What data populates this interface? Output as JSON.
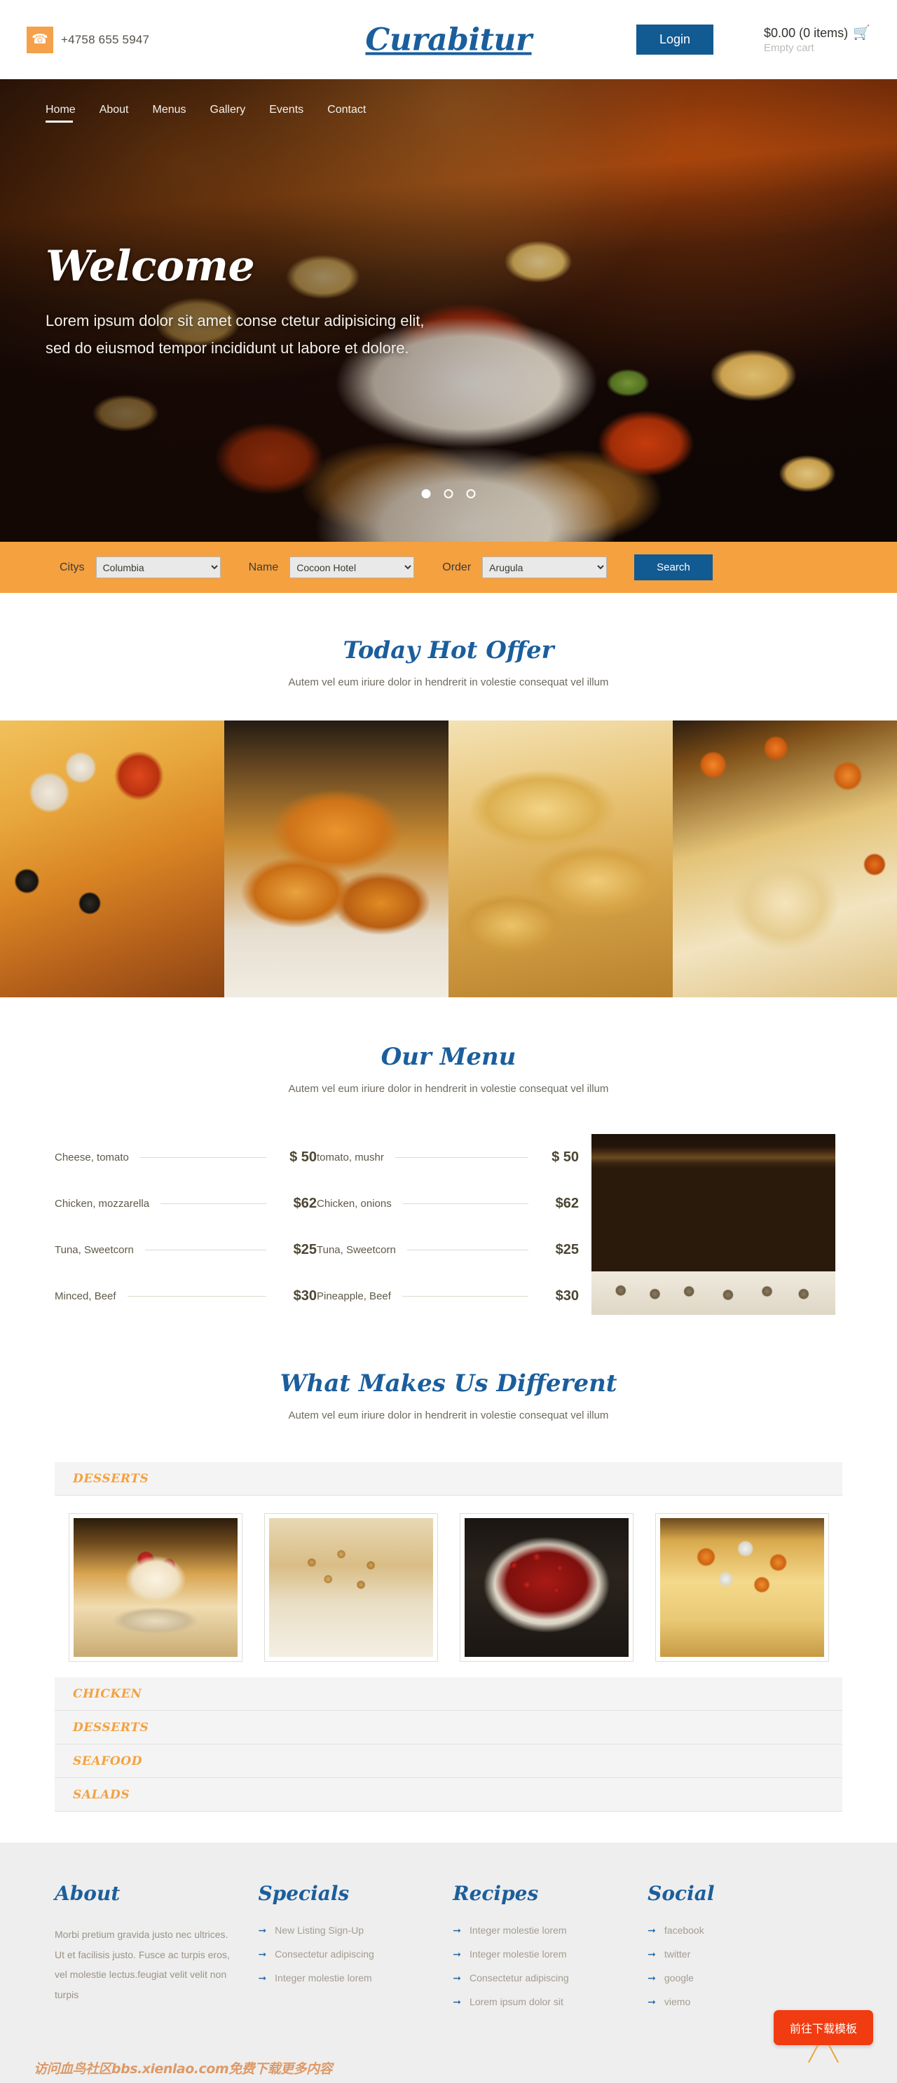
{
  "header": {
    "phone_icon": "phone-icon",
    "phone": "+4758 655 5947",
    "brand": "Curabitur",
    "login_label": "Login",
    "cart_total": "$0.00 (0 items)",
    "cart_icon": "shopping-cart-icon",
    "cart_status": "Empty cart"
  },
  "nav": {
    "items": [
      {
        "label": "Home",
        "active": true
      },
      {
        "label": "About",
        "active": false
      },
      {
        "label": "Menus",
        "active": false
      },
      {
        "label": "Gallery",
        "active": false
      },
      {
        "label": "Events",
        "active": false
      },
      {
        "label": "Contact",
        "active": false
      }
    ]
  },
  "hero": {
    "title": "Welcome",
    "line1": "Lorem ipsum dolor sit amet conse ctetur adipisicing elit,",
    "line2": "sed do eiusmod tempor incididunt ut labore et dolore.",
    "dots": [
      true,
      false,
      false
    ]
  },
  "searchbar": {
    "city_label": "Citys",
    "city_value": "Columbia",
    "city_options": [
      "Columbia"
    ],
    "name_label": "Name",
    "name_value": "Cocoon Hotel",
    "name_options": [
      "Cocoon Hotel"
    ],
    "order_label": "Order",
    "order_value": "Arugula",
    "order_options": [
      "Arugula"
    ],
    "search_label": "Search"
  },
  "hot_offer": {
    "title": "Today Hot Offer",
    "subtitle": "Autem vel eum iriure dolor in hendrerit in volestie consequat vel illum",
    "images": [
      "pizza-photo",
      "fried-chicken-photo",
      "chicken-wings-photo",
      "pastry-vegetables-photo"
    ]
  },
  "our_menu": {
    "title": "Our Menu",
    "subtitle": "Autem vel eum iriure dolor in hendrerit in volestie consequat vel illum",
    "left_items": [
      {
        "name": "Cheese, tomato",
        "price": "$ 50"
      },
      {
        "name": "Chicken, mozzarella",
        "price": "$62"
      },
      {
        "name": "Tuna, Sweetcorn",
        "price": "$25"
      },
      {
        "name": "Minced, Beef",
        "price": "$30"
      }
    ],
    "right_items": [
      {
        "name": "tomato, mushr",
        "price": "$ 50"
      },
      {
        "name": "Chicken, onions",
        "price": "$62"
      },
      {
        "name": "Tuna, Sweetcorn",
        "price": "$25"
      },
      {
        "name": "Pineapple, Beef",
        "price": "$30"
      }
    ],
    "photo": "chef-photo"
  },
  "different": {
    "title": "What Makes Us Different",
    "subtitle": "Autem vel eum iriure dolor in hendrerit in volestie consequat vel illum",
    "accordion": [
      {
        "label": "DESSERTS",
        "open": true
      },
      {
        "label": "CHICKEN",
        "open": false
      },
      {
        "label": "DESSERTS",
        "open": false
      },
      {
        "label": "SEAFOOD",
        "open": false
      },
      {
        "label": "SALADS",
        "open": false
      }
    ],
    "thumbs": [
      "cake-roll-photo",
      "nut-bar-photo",
      "berry-tart-photo",
      "fruit-cake-photo"
    ]
  },
  "footer": {
    "about": {
      "title": "About",
      "text": "Morbi pretium gravida justo nec ultrices. Ut et facilisis justo. Fusce ac turpis eros, vel molestie lectus.feugiat velit velit non turpis"
    },
    "specials": {
      "title": "Specials",
      "links": [
        "New Listing Sign-Up",
        "Consectetur adipiscing",
        "Integer molestie lorem"
      ]
    },
    "recipes": {
      "title": "Recipes",
      "links": [
        "Integer molestie lorem",
        "Integer molestie lorem",
        "Consectetur adipiscing",
        "Lorem ipsum dolor sit"
      ]
    },
    "social": {
      "title": "Social",
      "links": [
        "facebook",
        "twitter",
        "google",
        "viemo"
      ]
    },
    "arrow_icon": "arrow-right-icon"
  },
  "overlay": {
    "watermark": "访问血鸟社区bbs.xienlao.com免费下载更多内容",
    "download_button": "前往下载模板"
  },
  "colors": {
    "brand_blue": "#1b5e9c",
    "accent_orange": "#f5a13f",
    "button_blue": "#125a92",
    "download_red": "#f03c10"
  }
}
